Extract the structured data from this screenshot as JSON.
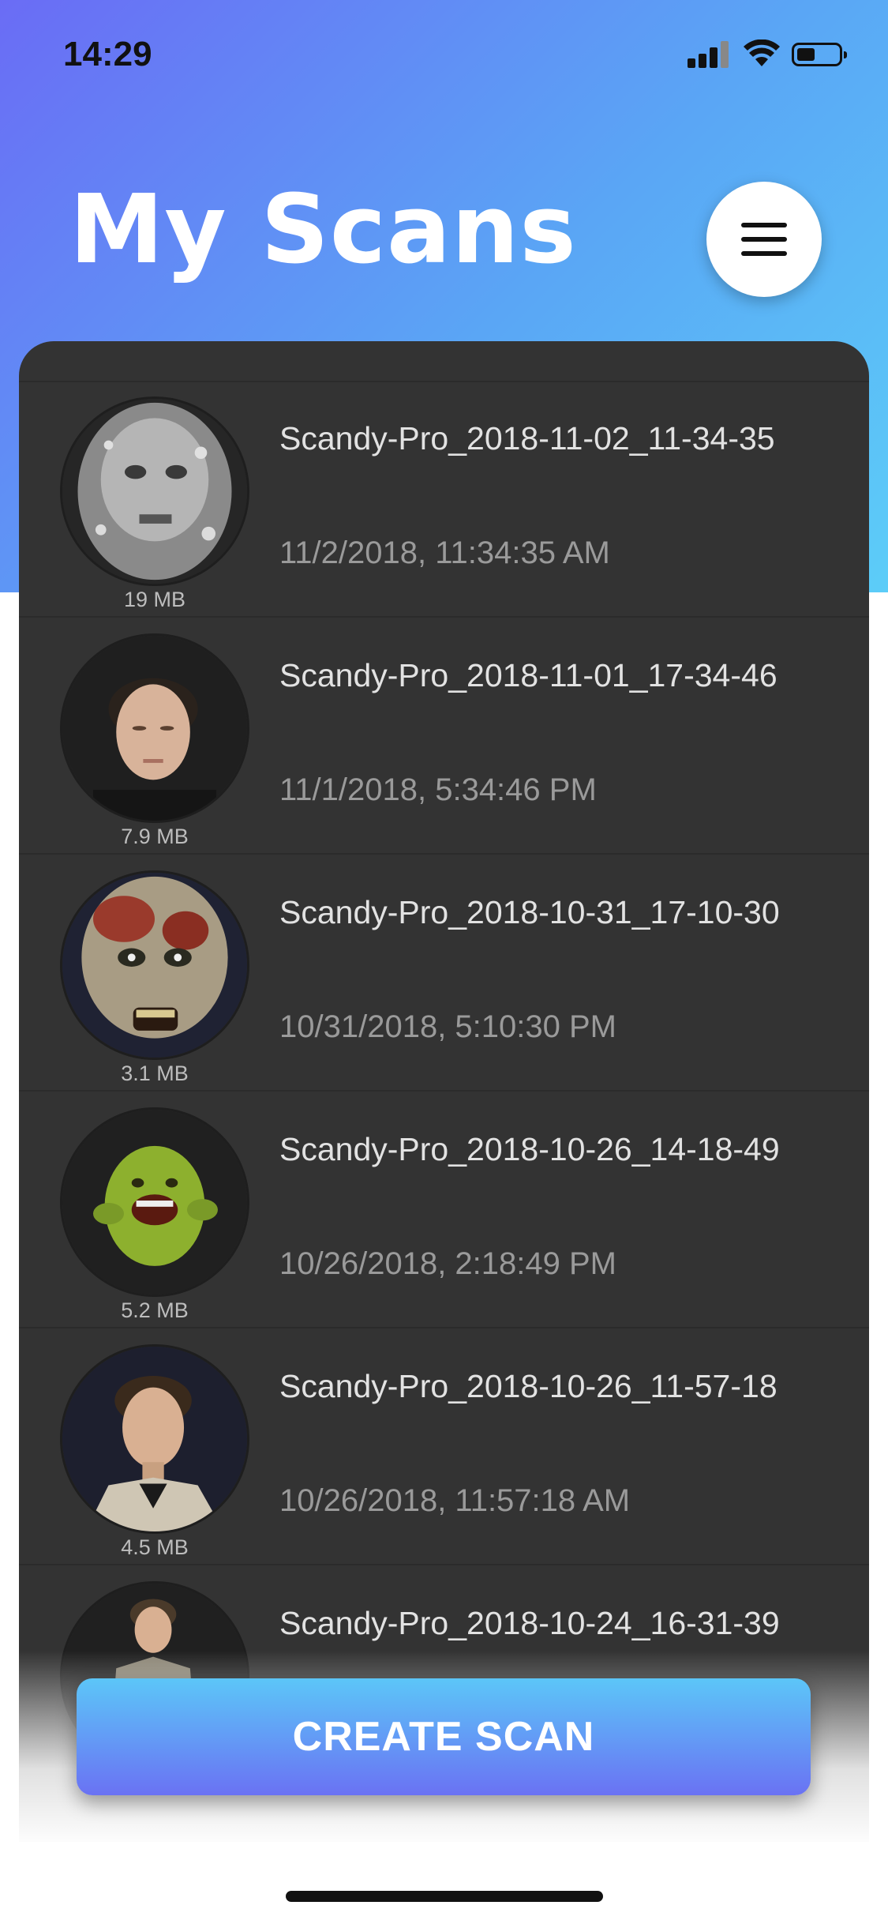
{
  "status_bar": {
    "time": "14:29",
    "icons": [
      "signal-icon",
      "wifi-icon",
      "battery-icon"
    ]
  },
  "header": {
    "title": "My Scans",
    "menu_icon": "hamburger-menu-icon"
  },
  "colors": {
    "header_gradient_start": "#6a6cf5",
    "header_gradient_end": "#5ccdf8",
    "panel_background": "#333333",
    "button_gradient_top": "#5cc6f8",
    "button_gradient_bottom": "#6a72f3"
  },
  "scans": [
    {
      "title": "Scandy-Pro_2018-11-02_11-34-35",
      "date": "11/2/2018, 11:34:35 AM",
      "size": "19 MB"
    },
    {
      "title": "Scandy-Pro_2018-11-01_17-34-46",
      "date": "11/1/2018, 5:34:46 PM",
      "size": "7.9 MB"
    },
    {
      "title": "Scandy-Pro_2018-10-31_17-10-30",
      "date": "10/31/2018, 5:10:30 PM",
      "size": "3.1 MB"
    },
    {
      "title": "Scandy-Pro_2018-10-26_14-18-49",
      "date": "10/26/2018, 2:18:49 PM",
      "size": "5.2 MB"
    },
    {
      "title": "Scandy-Pro_2018-10-26_11-57-18",
      "date": "10/26/2018, 11:57:18 AM",
      "size": "4.5 MB"
    },
    {
      "title": "Scandy-Pro_2018-10-24_16-31-39"
    }
  ],
  "create_button": {
    "label": "CREATE SCAN"
  }
}
